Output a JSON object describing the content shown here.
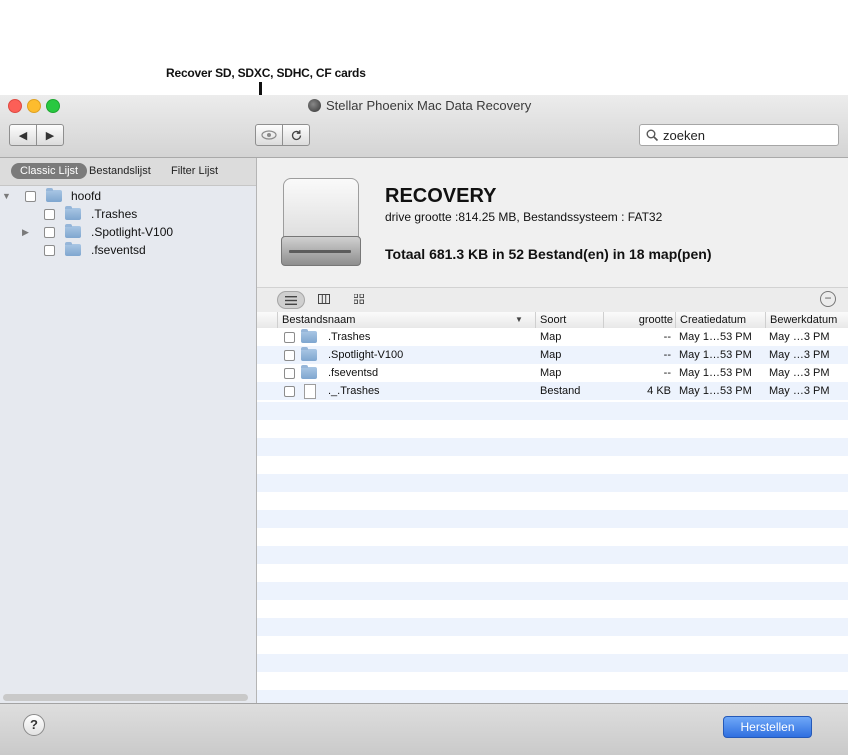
{
  "annotation": {
    "label": "Recover SD, SDXC, SDHC, CF cards"
  },
  "window": {
    "title": "Stellar Phoenix Mac Data Recovery"
  },
  "toolbar": {
    "back_icon": "◀",
    "forward_icon": "▶",
    "preview_icon": "👁",
    "reload_icon": "↺",
    "search_placeholder": "zoeken",
    "search_icon": "magnifier"
  },
  "sidebar": {
    "tabs": [
      {
        "label": "Classic Lijst",
        "active": true
      },
      {
        "label": "Bestandslijst",
        "active": false
      },
      {
        "label": "Filter Lijst",
        "active": false
      }
    ],
    "tree": [
      {
        "label": "hoofd",
        "expanded": true,
        "level": 0
      },
      {
        "label": ".Trashes",
        "expanded": false,
        "level": 1
      },
      {
        "label": ".Spotlight-V100",
        "expanded": false,
        "level": 1,
        "has_children": true
      },
      {
        "label": ".fseventsd",
        "expanded": false,
        "level": 1
      }
    ]
  },
  "volume": {
    "name": "RECOVERY",
    "info": "drive grootte :814.25 MB, Bestandssysteem : FAT32",
    "total": "Totaal 681.3 KB in 52 Bestand(en) in 18 map(pen)"
  },
  "table": {
    "headers": {
      "name": "Bestandsnaam",
      "kind": "Soort",
      "size": "grootte",
      "created": "Creatiedatum",
      "modified": "Bewerkdatum"
    },
    "rows": [
      {
        "name": ".Trashes",
        "kind": "Map",
        "size": "--",
        "created": "May 1…53 PM",
        "modified": "May …3 PM",
        "type": "folder"
      },
      {
        "name": ".Spotlight-V100",
        "kind": "Map",
        "size": "--",
        "created": "May 1…53 PM",
        "modified": "May …3 PM",
        "type": "folder"
      },
      {
        "name": ".fseventsd",
        "kind": "Map",
        "size": "--",
        "created": "May 1…53 PM",
        "modified": "May …3 PM",
        "type": "folder"
      },
      {
        "name": "._.Trashes",
        "kind": "Bestand",
        "size": "4 KB",
        "created": "May 1…53 PM",
        "modified": "May …3 PM",
        "type": "file"
      }
    ]
  },
  "footer": {
    "help_label": "?",
    "recover_label": "Herstellen"
  },
  "colors": {
    "accent": "#2f6fe0",
    "row_stripe": "#edf3fd",
    "sidebar_bg": "#e6e9ef"
  }
}
